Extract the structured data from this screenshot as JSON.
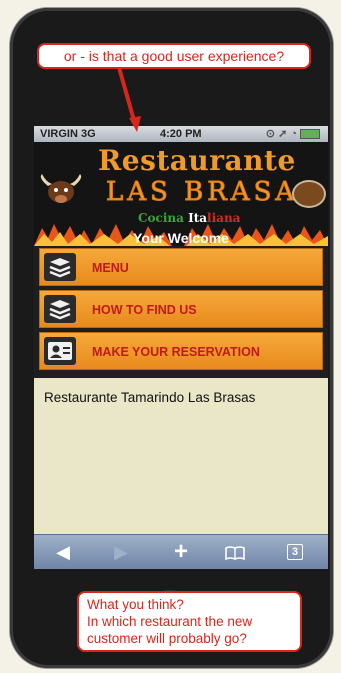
{
  "annotations": {
    "top": "or - is that a good user experience?",
    "bottom_lines": [
      "What you think?",
      "In which restaurant the new",
      "customer will probably go?"
    ]
  },
  "statusbar": {
    "carrier": "VIRGIN 3G",
    "time": "4:20 PM",
    "icons": "⊙ ➚ ◔"
  },
  "banner": {
    "title_line1": "Restaurante",
    "title_line2": "LAS BRASAS",
    "subtitle_part1": "Cocina ",
    "subtitle_part2": "Ita",
    "subtitle_part3": "liana",
    "welcome": "Your Welcome"
  },
  "menu": {
    "items": [
      {
        "label": "MENU",
        "icon": "layers-icon"
      },
      {
        "label": "HOW TO FIND US",
        "icon": "layers-icon"
      },
      {
        "label": "MAKE YOUR RESERVATION",
        "icon": "contact-card-icon"
      }
    ]
  },
  "content": {
    "text": "Restaurante Tamarindo Las Brasas"
  },
  "toolbar": {
    "back": "◀",
    "forward": "▶",
    "add": "+",
    "bookmarks": "📖",
    "tabs": "3"
  },
  "colors": {
    "accent": "#f09a2a",
    "annotation": "#d9261c",
    "menu_label": "#c21a1a"
  }
}
